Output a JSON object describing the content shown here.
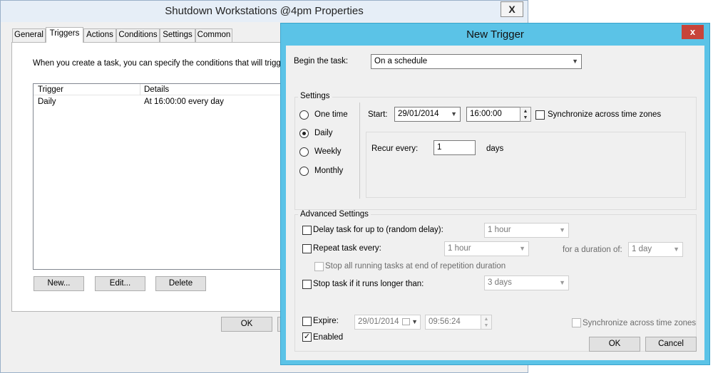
{
  "bg_window": {
    "title": "Shutdown Workstations @4pm Properties",
    "close_label": "X",
    "tabs": [
      "General",
      "Triggers",
      "Actions",
      "Conditions",
      "Settings",
      "Common"
    ],
    "description": "When you create a task, you can specify the conditions that will trigger th",
    "columns": [
      "Trigger",
      "Details"
    ],
    "rows": [
      {
        "trigger": "Daily",
        "details": "At 16:00:00 every day"
      }
    ],
    "buttons": {
      "new": "New...",
      "edit": "Edit...",
      "delete": "Delete",
      "ok": "OK"
    }
  },
  "dialog": {
    "title": "New Trigger",
    "close_label": "x",
    "begin_label": "Begin the task:",
    "begin_value": "On a schedule",
    "settings_label": "Settings",
    "schedule_options": [
      "One time",
      "Daily",
      "Weekly",
      "Monthly"
    ],
    "selected_option": "Daily",
    "start_label": "Start:",
    "start_date": "29/01/2014",
    "start_time": "16:00:00",
    "sync_label": "Synchronize across time zones",
    "recur_label": "Recur every:",
    "recur_value": "1",
    "recur_unit": "days",
    "advanced_label": "Advanced Settings",
    "delay_label": "Delay task for up to (random delay):",
    "delay_value": "1 hour",
    "repeat_label": "Repeat task every:",
    "repeat_value": "1 hour",
    "duration_label": "for a duration of:",
    "duration_value": "1 day",
    "stop_running_label": "Stop all running tasks at end of repetition duration",
    "stop_longer_label": "Stop task if it runs longer than:",
    "stop_longer_value": "3 days",
    "expire_label": "Expire:",
    "expire_date": "29/01/2014",
    "expire_time": "09:56:24",
    "expire_sync_label": "Synchronize across time zones",
    "enabled_label": "Enabled",
    "enabled_checked": true,
    "ok": "OK",
    "cancel": "Cancel"
  },
  "colors": {
    "dialog_frame": "#5bc3e7",
    "close_red": "#c7443a",
    "window_bg": "#f0f0f0"
  }
}
